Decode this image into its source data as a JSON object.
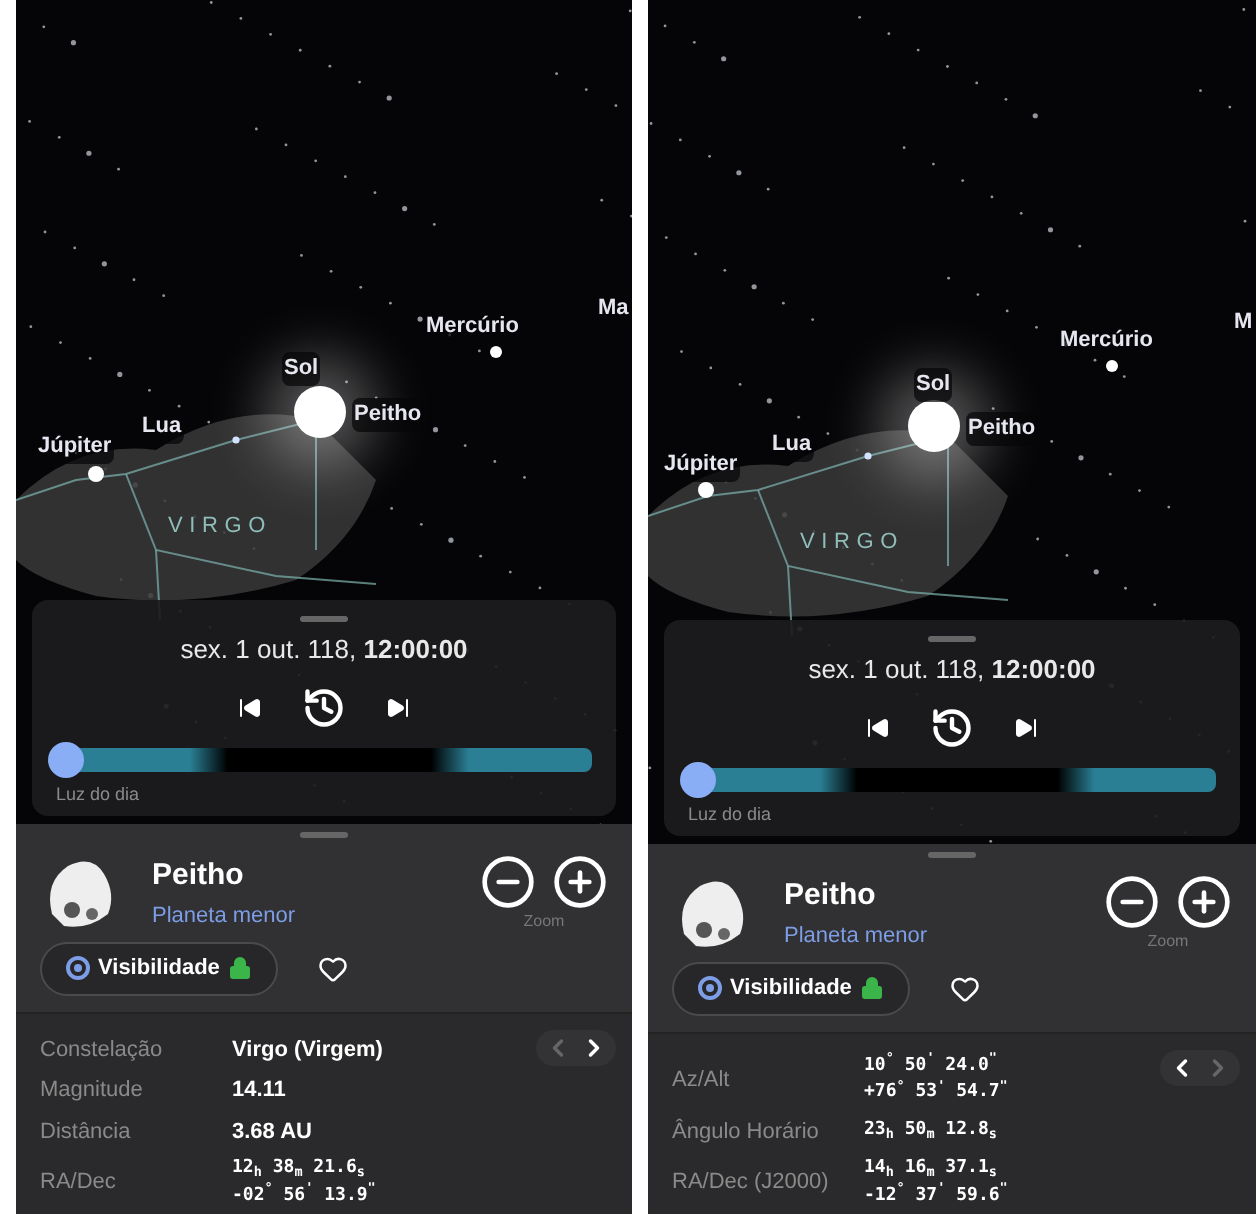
{
  "screens": [
    {
      "sky": {
        "labels": [
          {
            "text": "Mercúrio",
            "kind": "planet"
          },
          {
            "text": "Ma",
            "kind": "planet"
          },
          {
            "text": "Sol",
            "kind": "planet"
          },
          {
            "text": "Peitho",
            "kind": "planet"
          },
          {
            "text": "Lua",
            "kind": "planet"
          },
          {
            "text": "Júpiter",
            "kind": "planet"
          },
          {
            "text": "VIRGO",
            "kind": "constellation"
          }
        ]
      },
      "time_panel": {
        "date": "sex. 1 out. 118, **12:00:00**",
        "daylight_slider": {
          "level": 0.0,
          "label": "Luz do dia"
        }
      },
      "info": {
        "name": "Peitho",
        "type": "Planeta menor",
        "zoom_label": "Zoom",
        "visibility": "Visibilidade",
        "nav": [
          {
            "disabled": true
          },
          {
            "disabled": false
          }
        ],
        "rows": [
          {
            "label": "Constelação",
            "kind": "text",
            "values": [
              "Virgo (Virgem)"
            ]
          },
          {
            "label": "Magnitude",
            "kind": "text",
            "values": [
              "14.11"
            ]
          },
          {
            "label": "Distância",
            "kind": "text",
            "values": [
              "**3.68** AU"
            ]
          },
          {
            "label": "RA/Dec",
            "kind": "coords",
            "values": [
              "12$_{h}$ 38$_{m}$ 21.6$_{s}$",
              "-02$^{°}$ 56$^{'}$ 13.9$^{\"}$"
            ]
          }
        ]
      }
    },
    {
      "sky": {
        "labels": [
          {
            "text": "Mercúrio",
            "kind": "planet"
          },
          {
            "text": "M",
            "kind": "planet"
          },
          {
            "text": "Sol",
            "kind": "planet"
          },
          {
            "text": "Peitho",
            "kind": "planet"
          },
          {
            "text": "Lua",
            "kind": "planet"
          },
          {
            "text": "Júpiter",
            "kind": "planet"
          },
          {
            "text": "VIRGO",
            "kind": "constellation"
          }
        ]
      },
      "time_panel": {
        "date": "sex. 1 out. 118, **12:00:00**",
        "daylight_slider": {
          "level": 0.0,
          "label": "Luz do dia"
        }
      },
      "info": {
        "name": "Peitho",
        "type": "Planeta menor",
        "zoom_label": "Zoom",
        "visibility": "Visibilidade",
        "nav": [
          {
            "disabled": false
          },
          {
            "disabled": true
          }
        ],
        "rows": [
          {
            "label": "Az/Alt",
            "kind": "coords",
            "values": [
              "10$^{°}$ 50$^{'}$ 24.0$^{\"}$",
              "+76$^{°}$ 53$^{'}$ 54.7$^{\"}$"
            ]
          },
          {
            "label": "Ângulo Horário",
            "kind": "coords",
            "values": [
              "23$_{h}$ 50$_{m}$ 12.8$_{s}$"
            ]
          },
          {
            "label": "RA/Dec (J2000)",
            "kind": "coords",
            "values": [
              "14$_{h}$ 16$_{m}$ 37.1$_{s}$",
              "-12$^{°}$ 37$^{'}$ 59.6$^{\"}$"
            ]
          }
        ]
      }
    }
  ]
}
